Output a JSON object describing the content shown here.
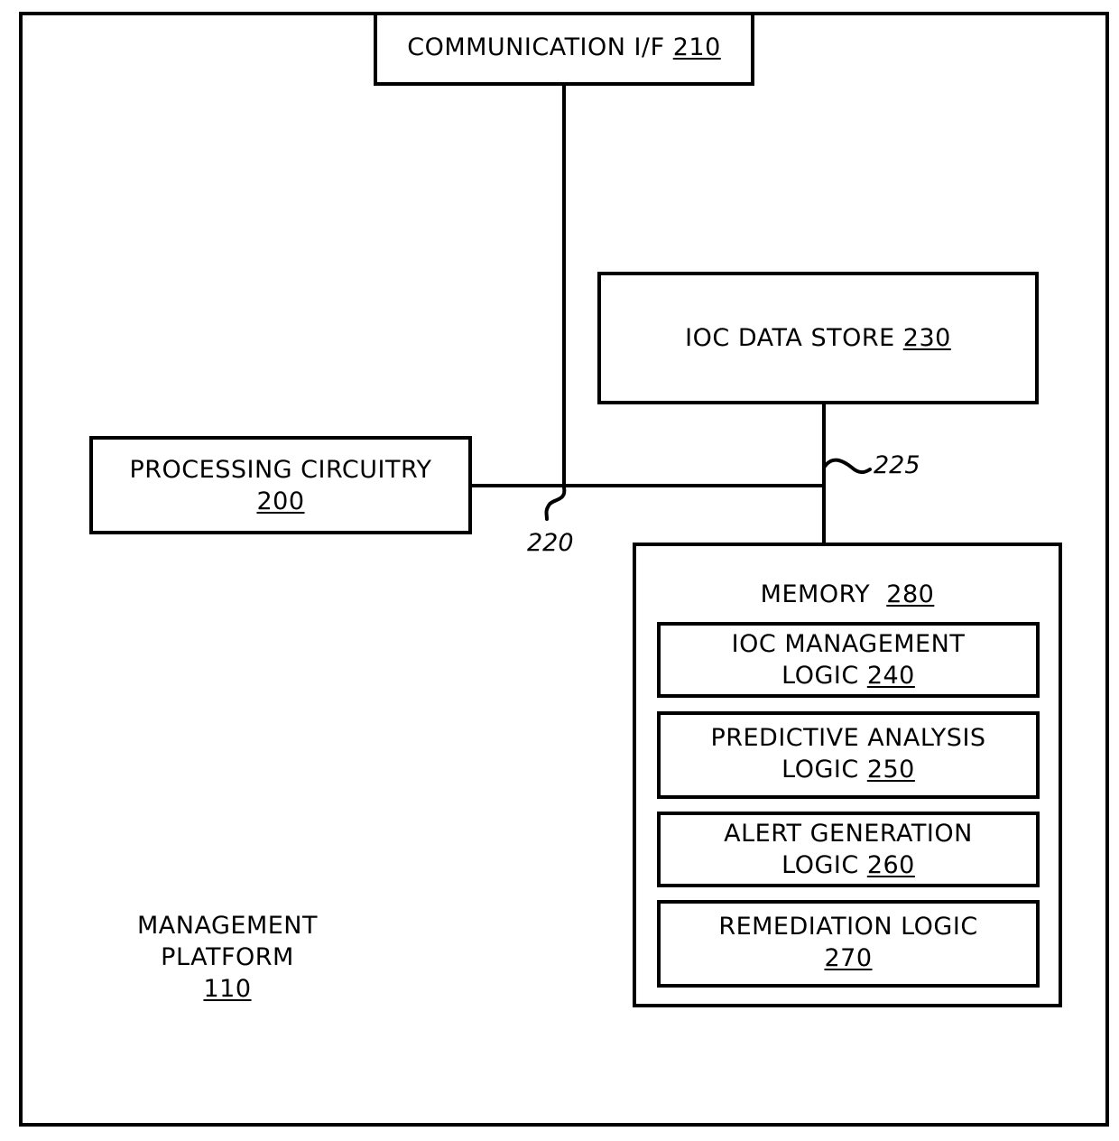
{
  "diagram": {
    "platform": {
      "title_line1": "MANAGEMENT",
      "title_line2": "PLATFORM",
      "ref": "110"
    },
    "communication_if": {
      "label": "COMMUNICATION I/F",
      "ref": "210"
    },
    "ioc_data_store": {
      "label": "IOC DATA STORE",
      "ref": "230"
    },
    "processing_circuitry": {
      "label": "PROCESSING CIRCUITRY",
      "ref": "200"
    },
    "bus_220": {
      "ref": "220"
    },
    "bus_225": {
      "ref": "225"
    },
    "memory": {
      "label": "MEMORY",
      "ref": "280",
      "modules": [
        {
          "line1": "IOC MANAGEMENT",
          "line2_prefix": "LOGIC",
          "ref": "240"
        },
        {
          "line1": "PREDICTIVE ANALYSIS",
          "line2_prefix": "LOGIC",
          "ref": "250"
        },
        {
          "line1": "ALERT GENERATION",
          "line2_prefix": "LOGIC",
          "ref": "260"
        },
        {
          "line1": "REMEDIATION LOGIC",
          "line2_prefix": "",
          "ref": "270"
        }
      ]
    }
  }
}
